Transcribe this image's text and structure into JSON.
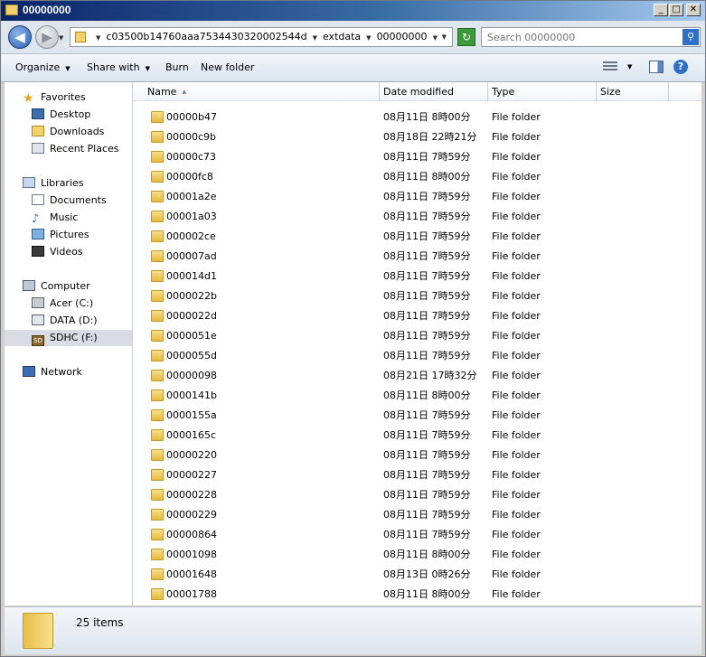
{
  "window": {
    "title": "00000000",
    "caption_buttons": [
      "minimize",
      "maximize",
      "close"
    ]
  },
  "address": {
    "crumbs": [
      "c03500b14760aaa7534430320002544d",
      "extdata",
      "00000000"
    ]
  },
  "search": {
    "placeholder": "Search 00000000"
  },
  "toolbar": {
    "organize_label": "Organize",
    "share_label": "Share with",
    "burn_label": "Burn",
    "new_folder_label": "New folder"
  },
  "navigation": {
    "favorites": {
      "label": "Favorites",
      "items": [
        "Desktop",
        "Downloads",
        "Recent Places"
      ]
    },
    "libraries": {
      "label": "Libraries",
      "items": [
        "Documents",
        "Music",
        "Pictures",
        "Videos"
      ]
    },
    "computer": {
      "label": "Computer",
      "items": [
        "Acer (C:)",
        "DATA (D:)",
        "SDHC (F:)"
      ],
      "selected": "SDHC (F:)"
    },
    "network": {
      "label": "Network"
    }
  },
  "columns": [
    "Name",
    "Date modified",
    "Type",
    "Size"
  ],
  "files": [
    {
      "name": "00000b47",
      "date": "08月11日 8時00分",
      "type": "File folder"
    },
    {
      "name": "00000c9b",
      "date": "08月18日 22時21分",
      "type": "File folder"
    },
    {
      "name": "00000c73",
      "date": "08月11日 7時59分",
      "type": "File folder"
    },
    {
      "name": "00000fc8",
      "date": "08月11日 8時00分",
      "type": "File folder"
    },
    {
      "name": "00001a2e",
      "date": "08月11日 7時59分",
      "type": "File folder"
    },
    {
      "name": "00001a03",
      "date": "08月11日 7時59分",
      "type": "File folder"
    },
    {
      "name": "000002ce",
      "date": "08月11日 7時59分",
      "type": "File folder"
    },
    {
      "name": "000007ad",
      "date": "08月11日 7時59分",
      "type": "File folder"
    },
    {
      "name": "000014d1",
      "date": "08月11日 7時59分",
      "type": "File folder"
    },
    {
      "name": "0000022b",
      "date": "08月11日 7時59分",
      "type": "File folder"
    },
    {
      "name": "0000022d",
      "date": "08月11日 7時59分",
      "type": "File folder"
    },
    {
      "name": "0000051e",
      "date": "08月11日 7時59分",
      "type": "File folder"
    },
    {
      "name": "0000055d",
      "date": "08月11日 7時59分",
      "type": "File folder"
    },
    {
      "name": "00000098",
      "date": "08月21日 17時32分",
      "type": "File folder"
    },
    {
      "name": "0000141b",
      "date": "08月11日 8時00分",
      "type": "File folder"
    },
    {
      "name": "0000155a",
      "date": "08月11日 7時59分",
      "type": "File folder"
    },
    {
      "name": "0000165c",
      "date": "08月11日 7時59分",
      "type": "File folder"
    },
    {
      "name": "00000220",
      "date": "08月11日 7時59分",
      "type": "File folder"
    },
    {
      "name": "00000227",
      "date": "08月11日 7時59分",
      "type": "File folder"
    },
    {
      "name": "00000228",
      "date": "08月11日 7時59分",
      "type": "File folder"
    },
    {
      "name": "00000229",
      "date": "08月11日 7時59分",
      "type": "File folder"
    },
    {
      "name": "00000864",
      "date": "08月11日 7時59分",
      "type": "File folder"
    },
    {
      "name": "00001098",
      "date": "08月11日 8時00分",
      "type": "File folder"
    },
    {
      "name": "00001648",
      "date": "08月13日 0時26分",
      "type": "File folder"
    },
    {
      "name": "00001788",
      "date": "08月11日 8時00分",
      "type": "File folder"
    }
  ],
  "status": {
    "item_count": "25 items"
  }
}
